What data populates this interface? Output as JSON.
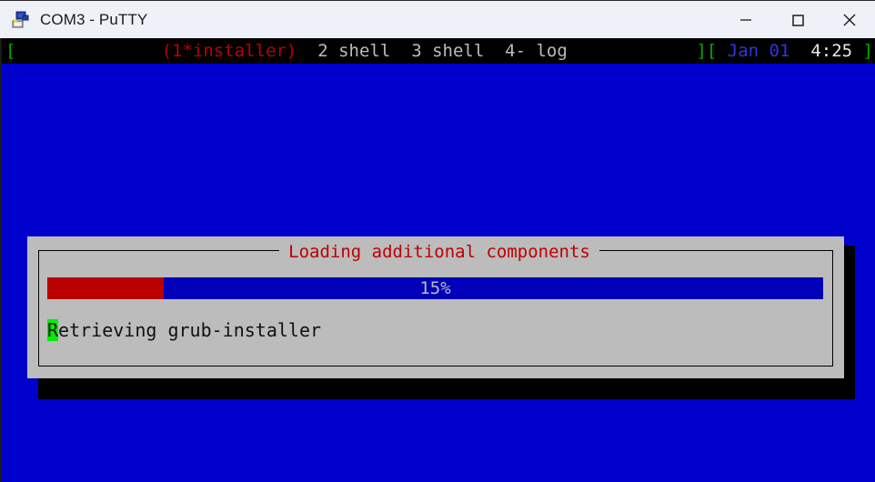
{
  "window": {
    "title": "COM3 - PuTTY",
    "icon": "putty-icon",
    "controls": {
      "minimize": "minimize-icon",
      "maximize": "maximize-icon",
      "close": "close-icon"
    }
  },
  "terminal": {
    "background_color": "#0000cc",
    "status_line": {
      "bracket_open": "[",
      "left_segments": [
        {
          "text": "(1*installer)",
          "color": "#bb0000"
        },
        {
          "text": "2 shell",
          "color": "#bbbbbb"
        },
        {
          "text": "3 shell",
          "color": "#bbbbbb"
        },
        {
          "text": "4- log",
          "color": "#bbbbbb"
        }
      ],
      "left_text": "(1*installer)  2 shell  3 shell  4- log",
      "right_bracket_close": "][",
      "date": "Jan 01",
      "time": "4:25",
      "bracket_close": "]"
    }
  },
  "dialog": {
    "title": "Loading additional components",
    "title_color": "#bb0000",
    "background_color": "#bcbcbc",
    "progress": {
      "percent_label": "15%",
      "percent_value": 15,
      "fill_color": "#bb0000",
      "track_color": "#0000bb",
      "label_color": "#bcbcbc"
    },
    "status_message": {
      "cursor_char": "R",
      "rest": "etrieving grub-installer",
      "full_text": "Retrieving grub-installer",
      "cursor_color": "#00ee00"
    }
  }
}
